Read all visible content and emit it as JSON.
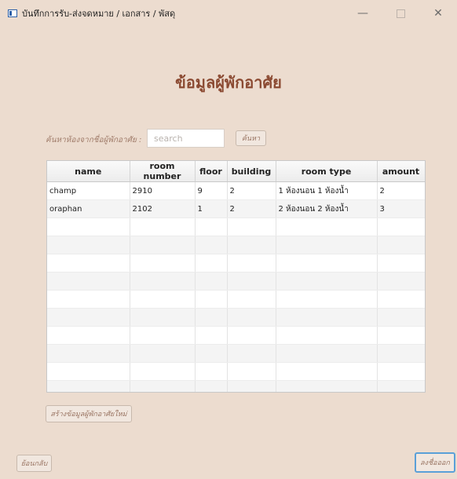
{
  "window": {
    "title": "บันทึกการรับ-ส่งจดหมาย / เอกสาร / พัสดุ",
    "minimize": "—",
    "close": "✕"
  },
  "page": {
    "heading": "ข้อมูลผู้พักอาศัย"
  },
  "search": {
    "label": "ค้นหาห้องจากชื่อผู้พักอาศัย :",
    "placeholder": "search",
    "button": "ค้นหา"
  },
  "table": {
    "columns": [
      "name",
      "room number",
      "floor",
      "building",
      "room type",
      "amount"
    ],
    "rows": [
      [
        "champ",
        "2910",
        "9",
        "2",
        "1 ห้องนอน 1 ห้องน้ำ",
        "2"
      ],
      [
        "oraphan",
        "2102",
        "1",
        "2",
        "2 ห้องนอน 2 ห้องน้ำ",
        "3"
      ]
    ]
  },
  "buttons": {
    "create": "สร้างข้อมูลผู้พักอาศัยใหม่",
    "back": "ย้อนกลับ",
    "logout": "ลงชื่อออก"
  }
}
